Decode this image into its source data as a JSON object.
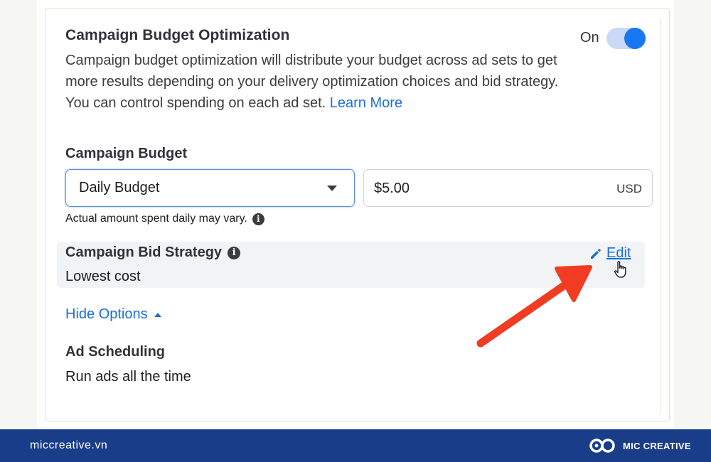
{
  "cbo": {
    "title": "Campaign Budget Optimization",
    "toggle_label": "On",
    "toggle_on": true,
    "description": "Campaign budget optimization will distribute your budget across ad sets to get more results depending on your delivery optimization choices and bid strategy. You can control spending on each ad set.",
    "learn_more": "Learn More"
  },
  "budget": {
    "heading": "Campaign Budget",
    "type_selected": "Daily Budget",
    "amount": "$5.00",
    "currency": "USD",
    "helper": "Actual amount spent daily may vary."
  },
  "bid_strategy": {
    "label": "Campaign Bid Strategy",
    "value": "Lowest cost",
    "edit_label": "Edit"
  },
  "options": {
    "toggle_label": "Hide Options"
  },
  "scheduling": {
    "heading": "Ad Scheduling",
    "value": "Run ads all the time"
  },
  "footer": {
    "site": "miccreative.vn",
    "brand": "MIC CREATIVE"
  },
  "colors": {
    "accent_blue": "#1877f2",
    "link_blue": "#1a6fd6",
    "annotation_red": "#f03c22",
    "footer_bg": "#1a3d8a"
  }
}
